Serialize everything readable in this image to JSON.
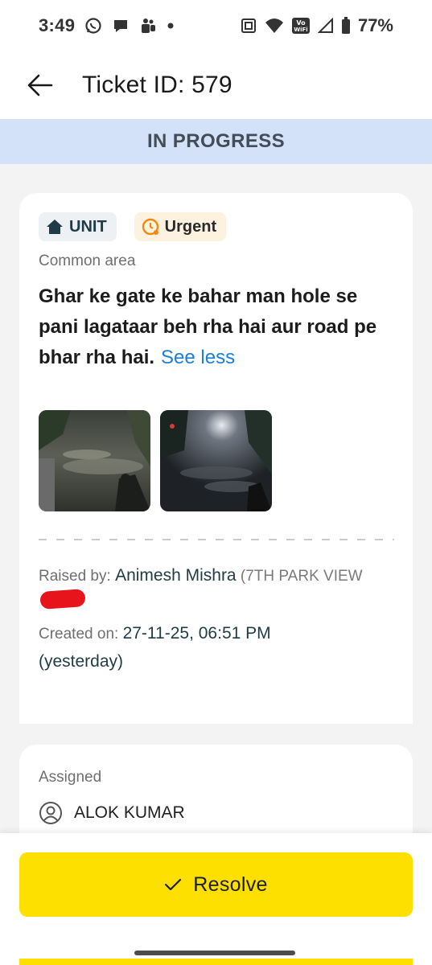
{
  "status_bar": {
    "time": "3:49",
    "battery": "77%",
    "volte_label": "Vo WiFi"
  },
  "header": {
    "title": "Ticket ID: 579"
  },
  "banner": {
    "status": "IN PROGRESS"
  },
  "ticket": {
    "tags": [
      {
        "label": "UNIT",
        "icon": "home-icon"
      },
      {
        "label": "Urgent",
        "icon": "urgent-clock-icon",
        "color": "#f08a12"
      }
    ],
    "category": "Common area",
    "description": "Ghar ke gate ke bahar man hole se pani lagataar beh rha hai aur road pe bhar rha hai.",
    "see_less": "See less",
    "raised_by_label": "Raised by:",
    "raised_by_name": "Animesh Mishra",
    "raised_by_sub": "(7TH PARK VIEW",
    "created_on_label": "Created on:",
    "created_on_value": "27-11-25, 06:51 PM",
    "created_on_relative": "(yesterday)"
  },
  "assigned": {
    "label": "Assigned",
    "name": "ALOK KUMAR"
  },
  "actions": {
    "resolve_label": "Resolve"
  },
  "colors": {
    "banner_bg": "#d3e2f8",
    "accent_yellow": "#fddf00",
    "link_blue": "#1a7fd9",
    "urgent_orange": "#f08a12"
  }
}
